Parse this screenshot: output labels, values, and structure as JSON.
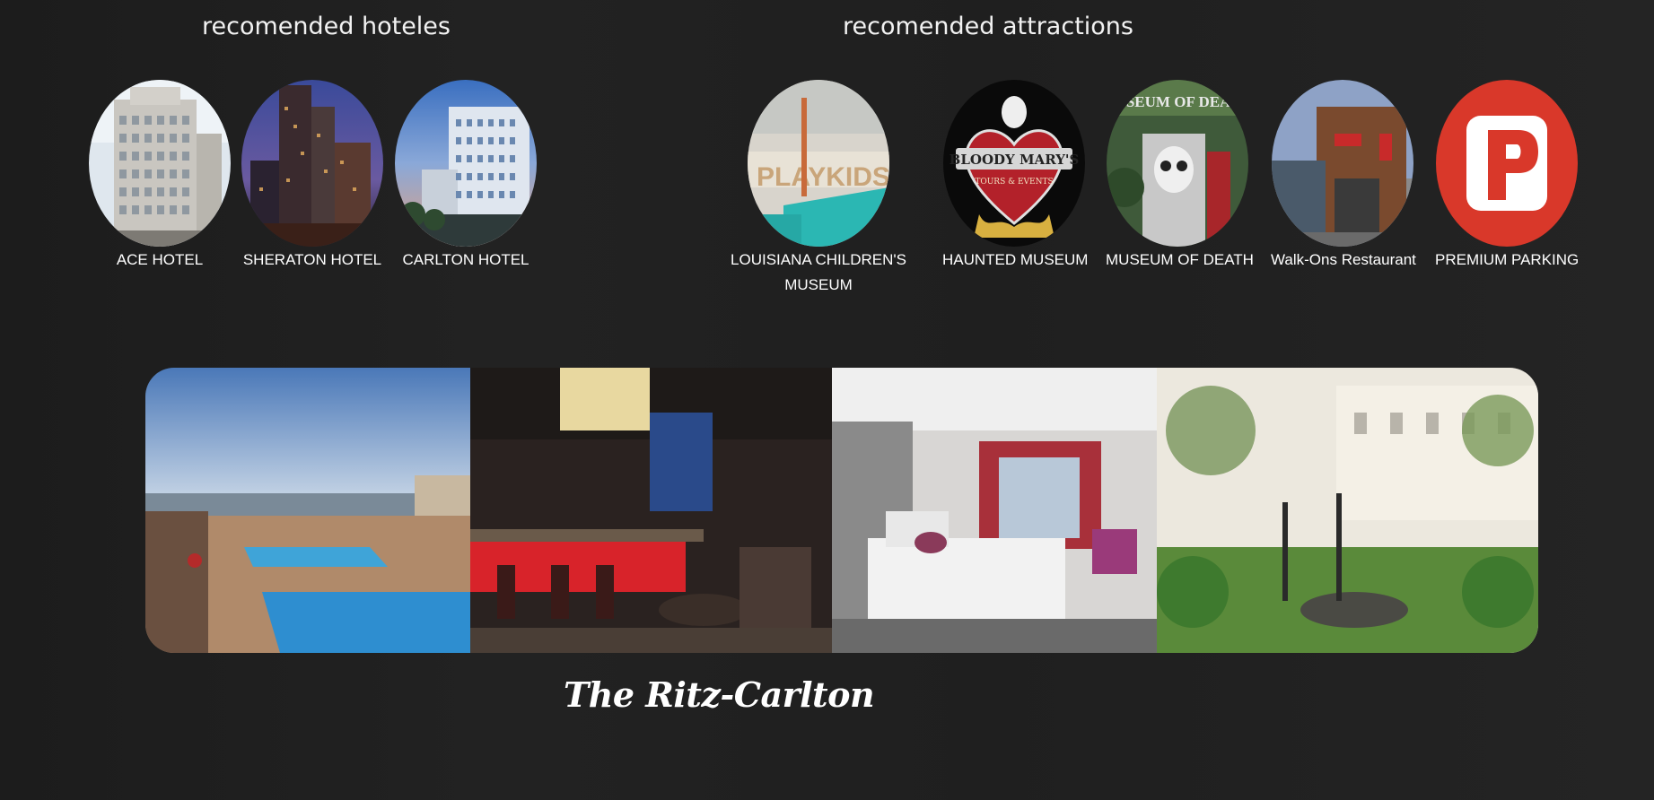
{
  "hotels": {
    "title": "recomended hoteles",
    "items": [
      {
        "label": "ACE HOTEL",
        "icon": "ace-hotel-photo"
      },
      {
        "label": "SHERATON HOTEL",
        "icon": "sheraton-hotel-photo"
      },
      {
        "label": "CARLTON HOTEL",
        "icon": "carlton-hotel-photo"
      }
    ]
  },
  "attractions": {
    "title": "recomended attractions",
    "items": [
      {
        "label": "LOUISIANA CHILDREN'S MUSEUM",
        "icon": "childrens-museum-photo"
      },
      {
        "label": "HAUNTED MUSEUM",
        "icon": "bloody-marys-logo",
        "logo_text": "BLOODY MARY'S",
        "logo_subtext": "TOURS & EVENTS"
      },
      {
        "label": "MUSEUM OF DEATH",
        "icon": "museum-of-death-photo"
      },
      {
        "label": "Walk-Ons Restaurant",
        "icon": "walk-ons-restaurant-photo"
      },
      {
        "label": "PREMIUM PARKING",
        "icon": "premium-parking-logo"
      }
    ]
  },
  "banner": {
    "caption": "The Ritz-Carlton",
    "panels": [
      "rooftop-pool-photo",
      "lounge-bar-photo",
      "hotel-room-photo",
      "courtyard-patio-photo"
    ]
  },
  "colors": {
    "background": "#1f1f1f",
    "parking_red": "#d9382a",
    "text": "#ffffff"
  }
}
